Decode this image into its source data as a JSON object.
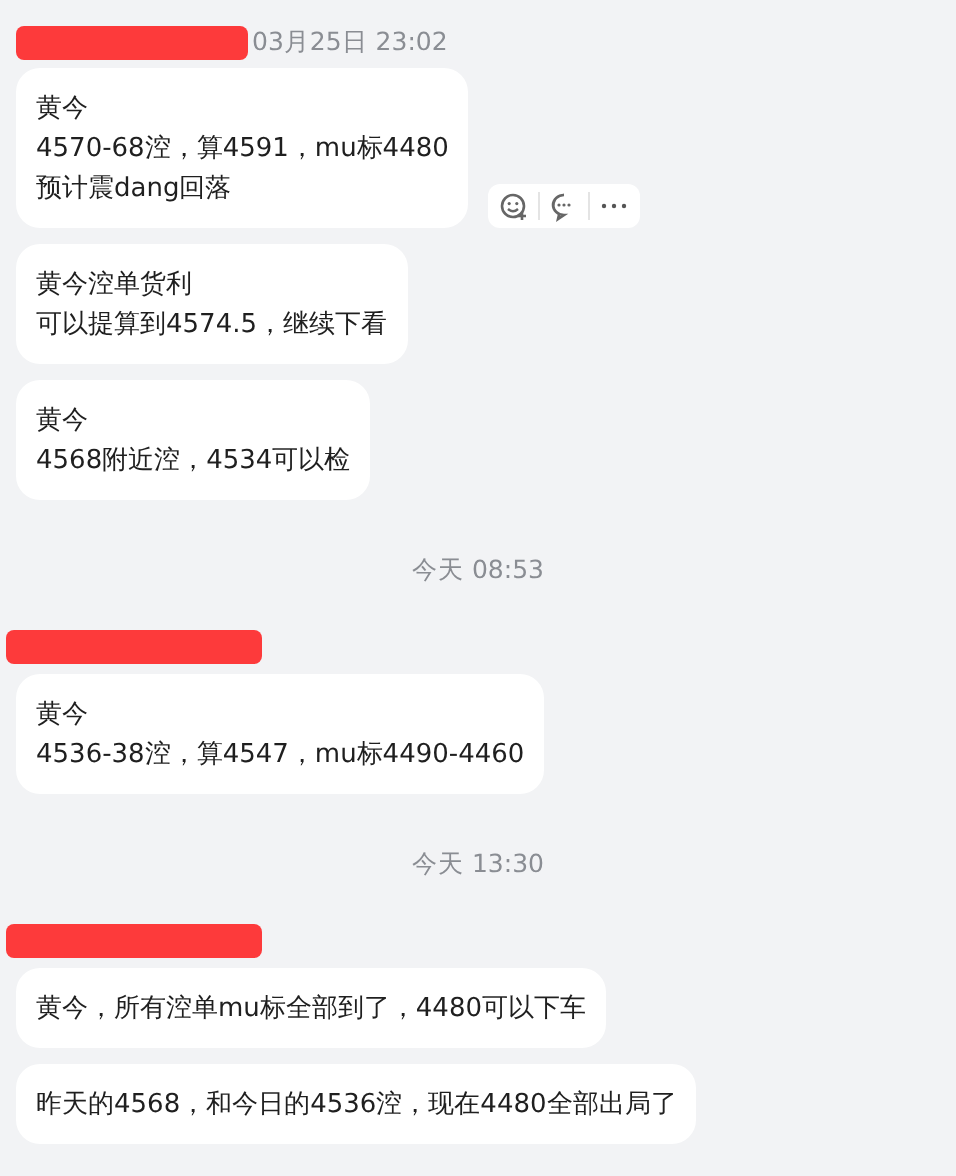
{
  "chat": [
    {
      "kind": "sender",
      "redacted": true,
      "time": "03月25日 23:02"
    },
    {
      "kind": "message",
      "lines": [
        "黄今",
        "4570-68涳，算4591，mu标4480",
        "预计震dang回落"
      ],
      "hover_actions": true
    },
    {
      "kind": "message",
      "lines": [
        "黄今涳单货利",
        "可以提算到4574.5，继续下看"
      ],
      "hover_actions": false
    },
    {
      "kind": "message",
      "lines": [
        "黄今",
        "4568附近涳，4534可以检"
      ],
      "hover_actions": false
    },
    {
      "kind": "time",
      "text": "今天 08:53"
    },
    {
      "kind": "sender",
      "redacted": true
    },
    {
      "kind": "message",
      "lines": [
        "黄今",
        "4536-38涳，算4547，mu标4490-4460"
      ],
      "hover_actions": false
    },
    {
      "kind": "time",
      "text": "今天 13:30"
    },
    {
      "kind": "sender",
      "redacted": true
    },
    {
      "kind": "message",
      "lines": [
        "黄今，所有涳单mu标全部到了，4480可以下车"
      ],
      "hover_actions": false
    },
    {
      "kind": "message",
      "lines": [
        "昨天的4568，和今日的4536涳，现在4480全部出局了"
      ],
      "hover_actions": false
    }
  ]
}
